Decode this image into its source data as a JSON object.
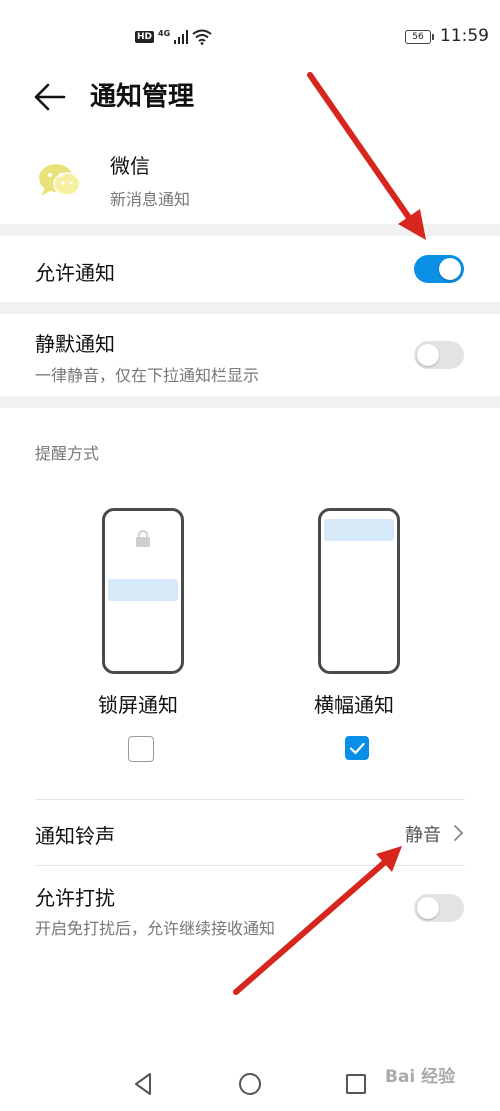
{
  "status_bar": {
    "hd": "HD",
    "network": "4G",
    "battery": "56",
    "time": "11:59",
    "icons": [
      "signal-icon",
      "wifi-icon",
      "battery-icon"
    ]
  },
  "header": {
    "title": "通知管理"
  },
  "app": {
    "name": "微信",
    "subtitle": "新消息通知",
    "icon": "wechat-icon"
  },
  "settings": {
    "allow": {
      "label": "允许通知",
      "enabled": true
    },
    "silent": {
      "label": "静默通知",
      "desc": "一律静音，仅在下拉通知栏显示",
      "enabled": false
    },
    "reminder_section": "提醒方式",
    "lockscreen": {
      "label": "锁屏通知",
      "checked": false
    },
    "banner": {
      "label": "横幅通知",
      "checked": true
    },
    "ringtone": {
      "label": "通知铃声",
      "value": "静音"
    },
    "disturb": {
      "label": "允许打扰",
      "desc": "开启免打扰后，允许继续接收通知",
      "enabled": false
    }
  },
  "nav": [
    "back-triangle-icon",
    "home-circle-icon",
    "recents-square-icon"
  ],
  "watermark": "Bai 经验",
  "colors": {
    "accent": "#0a8fe6",
    "annotation": "#d6261e",
    "band": "#f1f1f1"
  }
}
